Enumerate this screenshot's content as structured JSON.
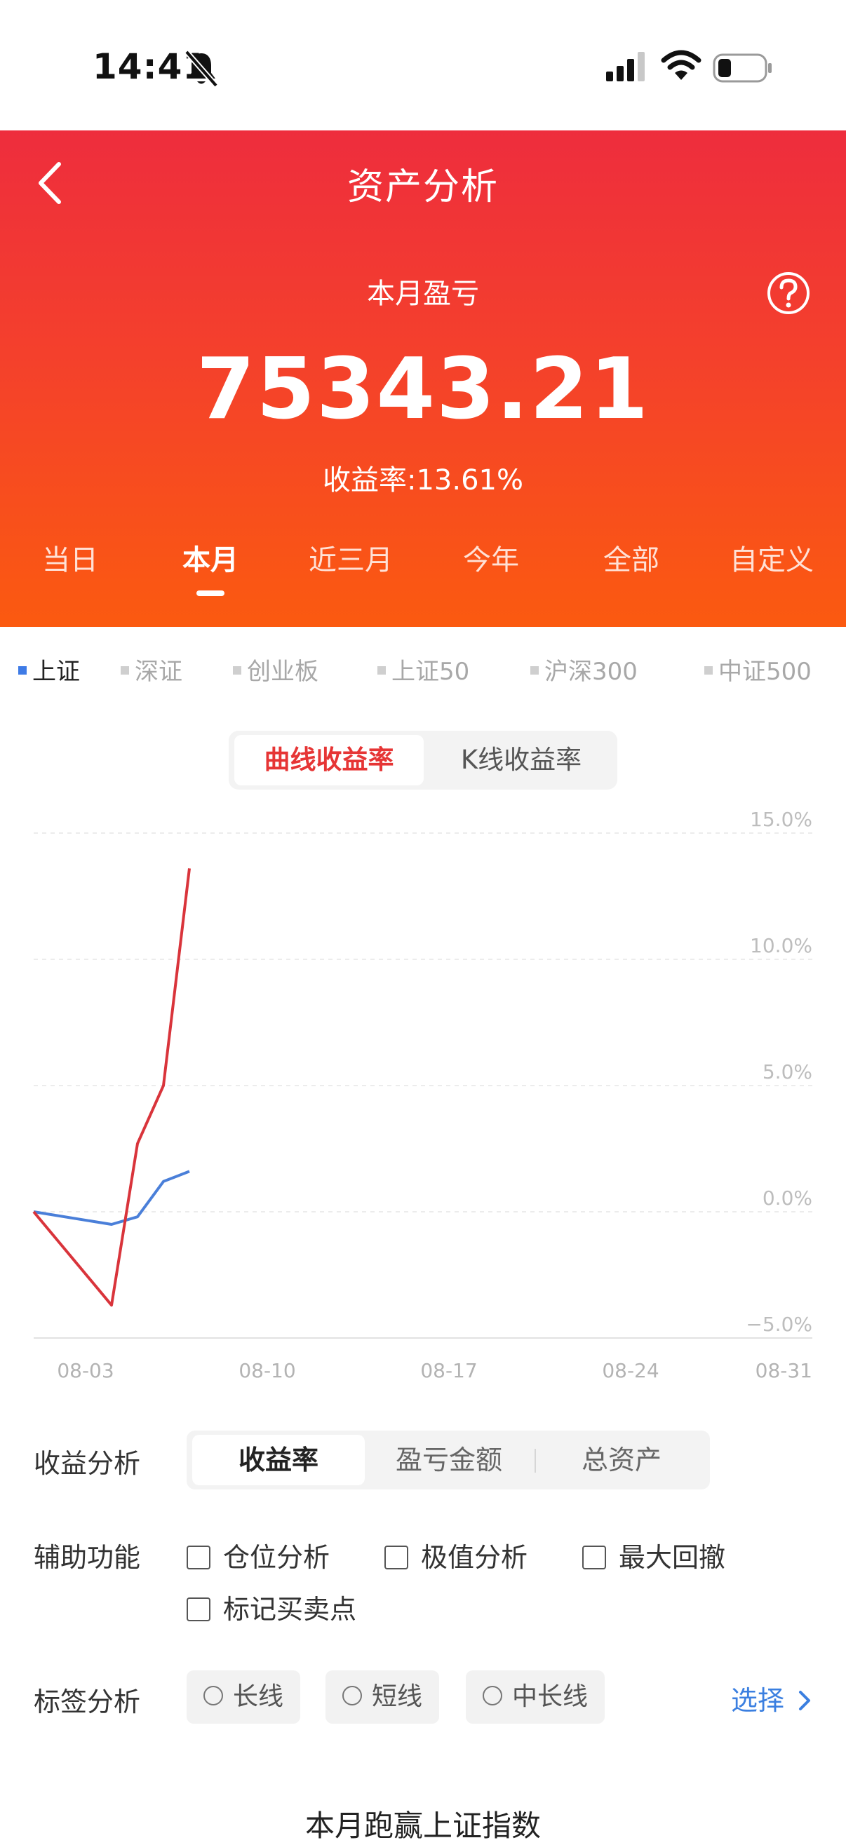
{
  "status_bar": {
    "time": "14:41"
  },
  "header": {
    "title": "资产分析",
    "subtitle": "本月盈亏",
    "pl_value": "75343.21",
    "rate_text": "收益率:13.61%"
  },
  "period_tabs": [
    {
      "label": "当日"
    },
    {
      "label": "本月"
    },
    {
      "label": "近三月"
    },
    {
      "label": "今年"
    },
    {
      "label": "全部"
    },
    {
      "label": "自定义"
    }
  ],
  "period_active": "本月",
  "index_tabs": [
    {
      "label": "上证"
    },
    {
      "label": "深证"
    },
    {
      "label": "创业板"
    },
    {
      "label": "上证50"
    },
    {
      "label": "沪深300"
    },
    {
      "label": "中证500"
    }
  ],
  "index_active": "上证",
  "chart_toggle": {
    "active": "曲线收益率",
    "other": "K线收益率"
  },
  "chart_data": {
    "type": "line",
    "x_ticks": [
      "08-03",
      "08-10",
      "08-17",
      "08-24",
      "08-31"
    ],
    "y_ticks": [
      "15.0%",
      "10.0%",
      "5.0%",
      "0.0%",
      "−5.0%"
    ],
    "ylim": [
      -5,
      15
    ],
    "xlim": [
      "08-01",
      "08-31"
    ],
    "grid": true,
    "series": [
      {
        "color": "#d9343b",
        "x": [
          "08-01",
          "08-04",
          "08-05",
          "08-06",
          "08-07"
        ],
        "y": [
          0.0,
          -3.7,
          2.7,
          5.0,
          13.6
        ]
      },
      {
        "color": "#4a7fd9",
        "x": [
          "08-01",
          "08-04",
          "08-05",
          "08-06",
          "08-07"
        ],
        "y": [
          0.0,
          -0.5,
          -0.2,
          1.2,
          1.6
        ]
      }
    ]
  },
  "analysis": {
    "label": "收益分析",
    "segments": [
      "收益率",
      "盈亏金额",
      "总资产"
    ]
  },
  "aux": {
    "label": "辅助功能",
    "options": [
      "仓位分析",
      "极值分析",
      "最大回撤",
      "标记买卖点"
    ]
  },
  "tags": {
    "label": "标签分析",
    "options": [
      "长线",
      "短线",
      "中长线"
    ],
    "select_label": "选择"
  },
  "bottom_title": "本月跑赢上证指数",
  "colors": {
    "accent_red": "#e63535",
    "link_blue": "#3b7fe0"
  }
}
